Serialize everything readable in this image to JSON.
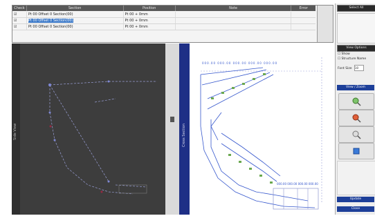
{
  "table": {
    "headers": [
      "Check",
      "Section",
      "Position",
      "Note",
      "Error"
    ],
    "rows": [
      {
        "check": "☑",
        "section": "Pt 00 Offset 0 Section(00)",
        "position": "Pt 00 + 0mm",
        "selected": false
      },
      {
        "check": "☑",
        "section": "Pt 00 Offset 0 Section(00)",
        "position": "Pt 00 + 0mm",
        "selected": true
      },
      {
        "check": "☑",
        "section": "Pt 00 Offset 0 Section(00)",
        "position": "Pt 00 + 0mm",
        "selected": false
      }
    ]
  },
  "right_panel": {
    "top_button": "Select All",
    "view_group": "View Options",
    "option_show": "Show",
    "option_structure": "Structure Name",
    "font_size_label": "Font Size",
    "font_size_value": "10",
    "zoom_group": "View / Zoom",
    "bottom_button_1": "Update",
    "bottom_button_2": "Close",
    "icons": [
      "zoom-in-icon",
      "zoom-out-icon",
      "zoom-fit-icon",
      "pan-icon"
    ]
  },
  "left_view": {
    "side_label": "Side View"
  },
  "right_view": {
    "side_label": "Cross Section",
    "top_labels": [
      "000.00",
      "000.00",
      "000.00",
      "000.00",
      "000.00"
    ],
    "bottom_labels": [
      "000.00",
      "000.00",
      "000.00",
      "000.00"
    ]
  },
  "colors": {
    "dark_view_bg": "#3d3d3d",
    "blue_strip": "#1e2f86",
    "selection": "#3a78c8",
    "green_markers": "#6aa84f",
    "blue_lines": "#3355cc"
  }
}
